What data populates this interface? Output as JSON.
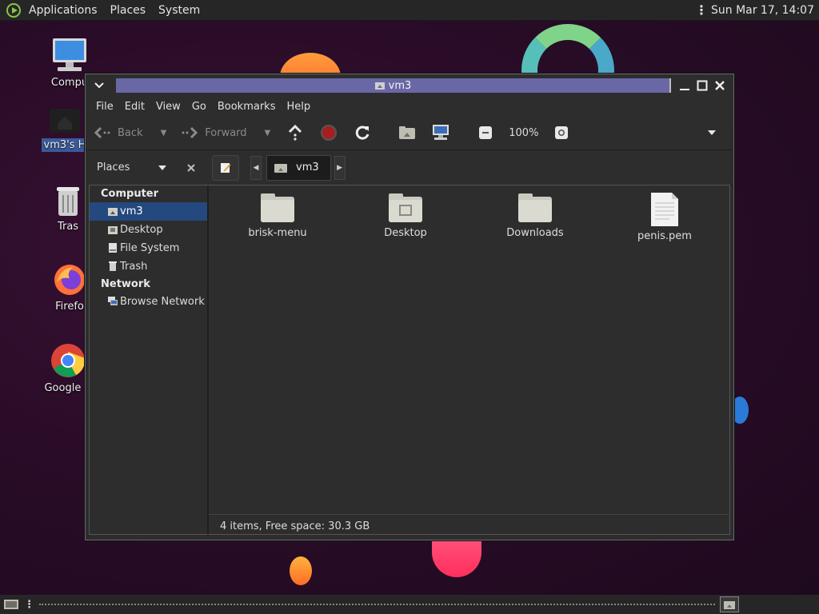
{
  "top_panel": {
    "menus": [
      "Applications",
      "Places",
      "System"
    ],
    "clock": "Sun Mar 17, 14:07"
  },
  "desktop_icons": [
    {
      "label": "Compu",
      "icon": "computer-icon"
    },
    {
      "label": "vm3's H",
      "icon": "home-folder-icon",
      "selected": true
    },
    {
      "label": "Tras",
      "icon": "trash-icon"
    },
    {
      "label": "Firefo",
      "icon": "firefox-icon"
    },
    {
      "label": "Google C",
      "icon": "chrome-icon"
    }
  ],
  "window": {
    "title": "vm3",
    "menu": [
      "File",
      "Edit",
      "View",
      "Go",
      "Bookmarks",
      "Help"
    ],
    "toolbar": {
      "back_label": "Back",
      "forward_label": "Forward",
      "zoom": "100%"
    },
    "places_label": "Places",
    "breadcrumb": "vm3",
    "sidebar": {
      "sections": [
        {
          "title": "Computer",
          "items": [
            {
              "label": "vm3",
              "icon": "home-icon",
              "selected": true
            },
            {
              "label": "Desktop",
              "icon": "desktop-icon"
            },
            {
              "label": "File System",
              "icon": "drive-icon"
            },
            {
              "label": "Trash",
              "icon": "trash-icon"
            }
          ]
        },
        {
          "title": "Network",
          "items": [
            {
              "label": "Browse Network",
              "icon": "network-icon"
            }
          ]
        }
      ]
    },
    "files": [
      {
        "name": "brisk-menu",
        "icon": "folder-icon"
      },
      {
        "name": "Desktop",
        "icon": "desktop-folder-icon"
      },
      {
        "name": "Downloads",
        "icon": "folder-icon"
      },
      {
        "name": "penis.pem",
        "icon": "text-file-icon"
      }
    ],
    "status": "4 items, Free space: 30.3 GB"
  }
}
